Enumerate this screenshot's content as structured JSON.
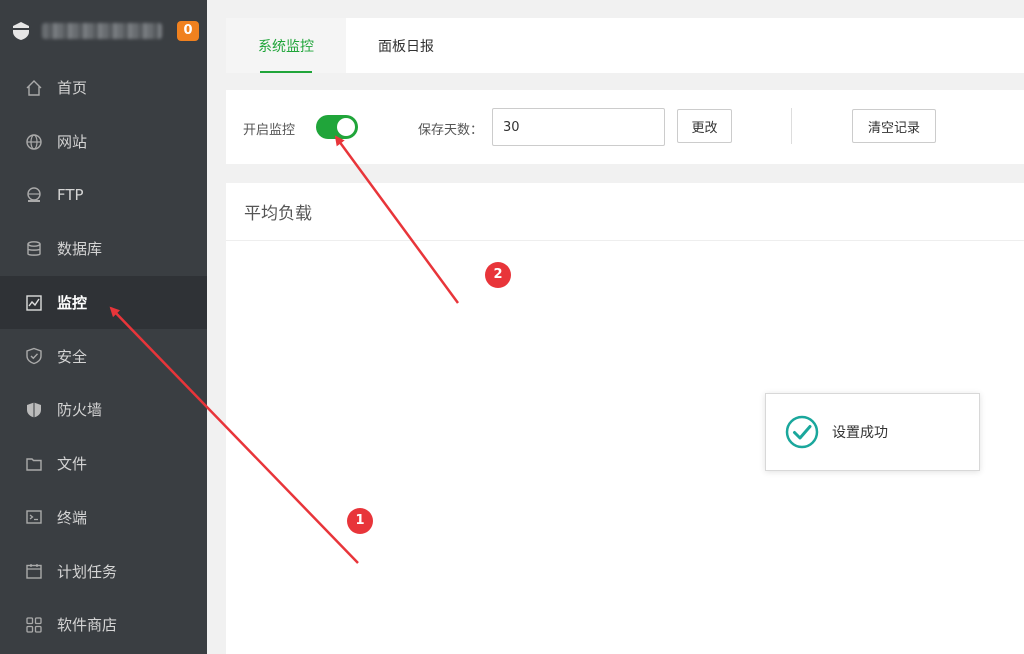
{
  "sidebar": {
    "badge_count": "0",
    "items": [
      {
        "label": "首页",
        "icon": "home-icon"
      },
      {
        "label": "网站",
        "icon": "globe-icon"
      },
      {
        "label": "FTP",
        "icon": "ftp-icon"
      },
      {
        "label": "数据库",
        "icon": "database-icon"
      },
      {
        "label": "监控",
        "icon": "monitor-icon",
        "active": true
      },
      {
        "label": "安全",
        "icon": "shield-check-icon"
      },
      {
        "label": "防火墙",
        "icon": "firewall-shield-icon"
      },
      {
        "label": "文件",
        "icon": "folder-icon"
      },
      {
        "label": "终端",
        "icon": "terminal-icon"
      },
      {
        "label": "计划任务",
        "icon": "calendar-icon"
      },
      {
        "label": "软件商店",
        "icon": "grid-icon"
      }
    ]
  },
  "tabs": [
    {
      "label": "系统监控",
      "active": true
    },
    {
      "label": "面板日报",
      "active": false
    }
  ],
  "controls": {
    "enable_label": "开启监控",
    "enable_on": true,
    "days_label": "保存天数：",
    "days_value": "30",
    "change_button": "更改",
    "clear_button": "清空记录"
  },
  "panel": {
    "title": "平均负载"
  },
  "toast": {
    "message": "设置成功",
    "icon": "check-circle-icon"
  },
  "annotations": [
    {
      "number": "1"
    },
    {
      "number": "2"
    }
  ],
  "colors": {
    "accent": "#20a53a",
    "sidebar_bg": "#3a3e42",
    "badge": "#f0811f",
    "annotation": "#e8353a"
  }
}
